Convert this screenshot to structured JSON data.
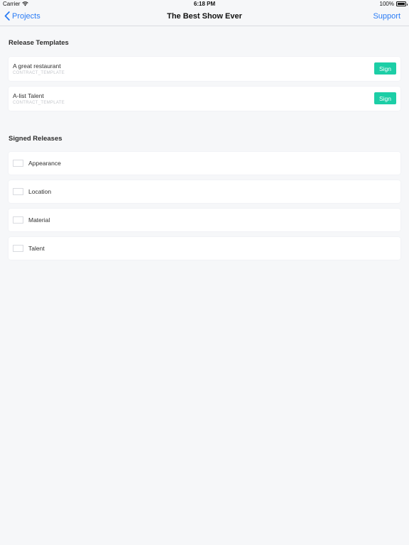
{
  "status": {
    "carrier": "Carrier",
    "time": "6:18 PM",
    "battery": "100%"
  },
  "nav": {
    "back_label": "Projects",
    "title": "The Best Show Ever",
    "support_label": "Support"
  },
  "release_templates": {
    "title": "Release Templates",
    "items": [
      {
        "name": "A great restaurant",
        "subtitle": "CONTRACT_TEMPLATE",
        "action": "Sign"
      },
      {
        "name": "A-list Talent",
        "subtitle": "CONTRACT_TEMPLATE",
        "action": "Sign"
      }
    ]
  },
  "signed_releases": {
    "title": "Signed Releases",
    "items": [
      {
        "label": "Appearance"
      },
      {
        "label": "Location"
      },
      {
        "label": "Material"
      },
      {
        "label": "Talent"
      }
    ]
  },
  "colors": {
    "accent": "#2a7cf5",
    "sign_button": "#1ccea6",
    "background": "#f6f7f9"
  },
  "icons": {
    "back": "chevron-left-icon",
    "wifi": "wifi-icon",
    "battery": "battery-icon"
  }
}
